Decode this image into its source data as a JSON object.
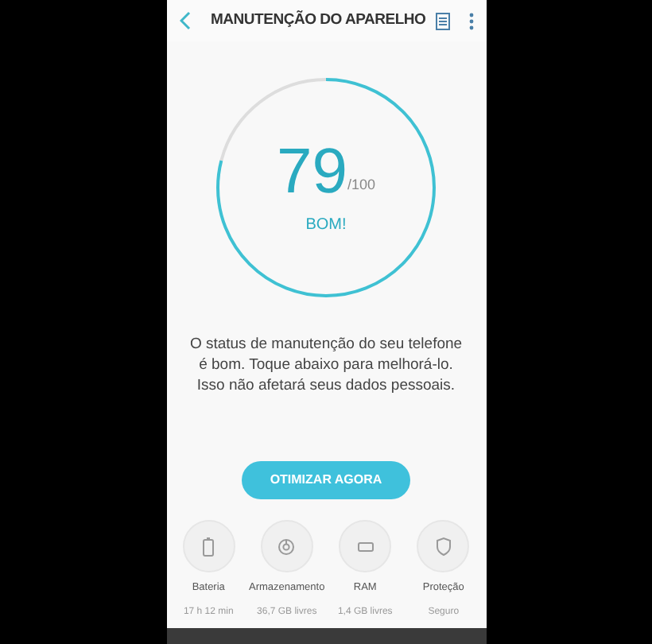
{
  "header": {
    "title": "MANUTENÇÃO DO APARELHO"
  },
  "score": {
    "value": "79",
    "max": "/100",
    "status": "BOM!",
    "level": 0.79
  },
  "message": "O status de manutenção do seu telefone é bom. Toque abaixo para melhorá-lo. Isso não afetará seus dados pessoais.",
  "action_button": "OTIMIZAR AGORA",
  "items": [
    {
      "kind": "battery",
      "label": "Bateria",
      "value": "17 h 12 min"
    },
    {
      "kind": "storage",
      "label": "Armazenamento",
      "value": "36,7 GB livres"
    },
    {
      "kind": "ram",
      "label": "RAM",
      "value": "1,4 GB livres"
    },
    {
      "kind": "security",
      "label": "Proteção",
      "value": "Seguro"
    }
  ]
}
